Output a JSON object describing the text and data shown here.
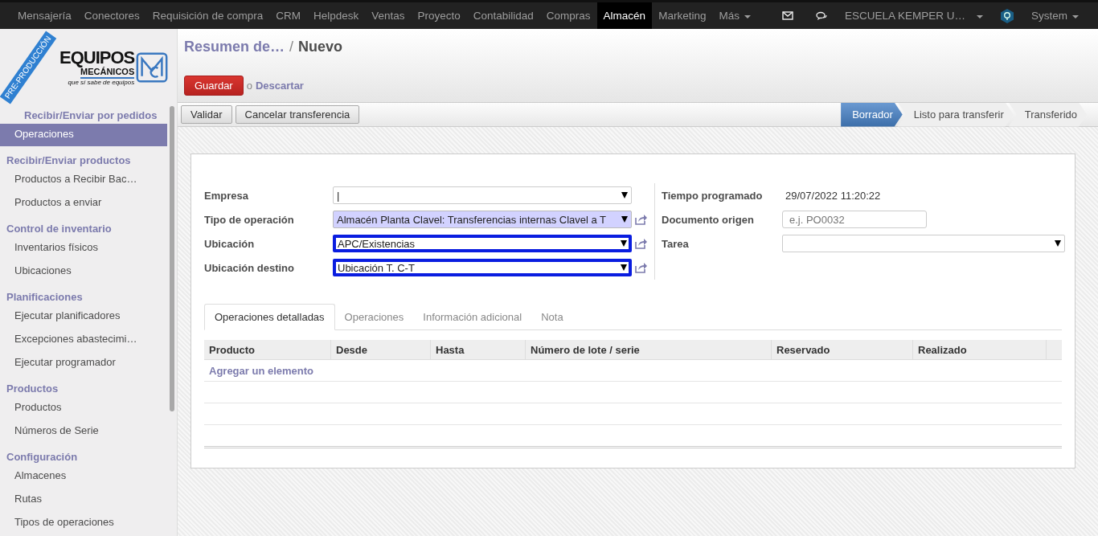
{
  "top_menu": [
    {
      "label": "Mensajería",
      "selected": false
    },
    {
      "label": "Conectores",
      "selected": false
    },
    {
      "label": "Requisición de compra",
      "selected": false
    },
    {
      "label": "CRM",
      "selected": false
    },
    {
      "label": "Helpdesk",
      "selected": false
    },
    {
      "label": "Ventas",
      "selected": false
    },
    {
      "label": "Proyecto",
      "selected": false
    },
    {
      "label": "Contabilidad",
      "selected": false
    },
    {
      "label": "Compras",
      "selected": false
    },
    {
      "label": "Almacén",
      "selected": true
    },
    {
      "label": "Marketing",
      "selected": false
    },
    {
      "label": "Más",
      "selected": false
    }
  ],
  "company": "ESCUELA KEMPER U…",
  "user": "System",
  "logo": {
    "line1": "EQUIPOS",
    "line2": "MECÁNICOS",
    "tagline": "que sí sabe de equipos",
    "ribbon": "PRE-PRODUCCIÓN"
  },
  "sidebar": [
    {
      "title": "Recibir/Enviar por pedidos",
      "items": [
        {
          "label": "Operaciones",
          "selected": true
        }
      ]
    },
    {
      "title": "Recibir/Enviar productos",
      "items": [
        {
          "label": "Productos a Recibir Bac…",
          "selected": false
        },
        {
          "label": "Productos a enviar",
          "selected": false
        }
      ]
    },
    {
      "title": "Control de inventario",
      "items": [
        {
          "label": "Inventarios físicos",
          "selected": false
        },
        {
          "label": "Ubicaciones",
          "selected": false
        }
      ]
    },
    {
      "title": "Planificaciones",
      "items": [
        {
          "label": "Ejecutar planificadores",
          "selected": false
        },
        {
          "label": "Excepciones abastecimi…",
          "selected": false
        },
        {
          "label": "Ejecutar programador",
          "selected": false
        }
      ]
    },
    {
      "title": "Productos",
      "items": [
        {
          "label": "Productos",
          "selected": false
        },
        {
          "label": "Números de Serie",
          "selected": false
        }
      ]
    },
    {
      "title": "Configuración",
      "items": [
        {
          "label": "Almacenes",
          "selected": false
        },
        {
          "label": "Rutas",
          "selected": false
        },
        {
          "label": "Tipos de operaciones",
          "selected": false
        }
      ]
    }
  ],
  "breadcrumb": {
    "parent": "Resumen de…",
    "separator": "/",
    "current": "Nuevo"
  },
  "save": "Guardar",
  "or": "o",
  "discard": "Descartar",
  "actions": [
    "Validar",
    "Cancelar transferencia"
  ],
  "stages": [
    {
      "label": "Borrador",
      "selected": true
    },
    {
      "label": "Listo para transferir",
      "selected": false
    },
    {
      "label": "Transferido",
      "selected": false
    }
  ],
  "left_fields": [
    {
      "label": "Empresa",
      "value": "|",
      "highlighted": false,
      "link": false,
      "outlined": false
    },
    {
      "label": "Tipo de operación",
      "value": "Almacén Planta Clavel: Transferencias internas Clavel a T",
      "highlighted": true,
      "link": true,
      "outlined": false
    },
    {
      "label": "Ubicación",
      "value": "APC/Existencias",
      "highlighted": false,
      "link": true,
      "outlined": true
    },
    {
      "label": "Ubicación destino",
      "value": "Ubicación T. C-T",
      "highlighted": false,
      "link": true,
      "outlined": true
    }
  ],
  "right_fields": [
    {
      "label": "Tiempo programado",
      "kind": "text",
      "value": "29/07/2022 11:20:22"
    },
    {
      "label": "Documento origen",
      "kind": "input",
      "placeholder": "e.j. PO0032"
    },
    {
      "label": "Tarea",
      "kind": "select"
    }
  ],
  "tabs": [
    {
      "label": "Operaciones detalladas",
      "selected": true
    },
    {
      "label": "Operaciones",
      "selected": false
    },
    {
      "label": "Información adicional",
      "selected": false
    },
    {
      "label": "Nota",
      "selected": false
    }
  ],
  "table": {
    "columns": [
      "Producto",
      "Desde",
      "Hasta",
      "Número de lote / serie",
      "Reservado",
      "Realizado"
    ],
    "add_link": "Agregar un elemento"
  }
}
